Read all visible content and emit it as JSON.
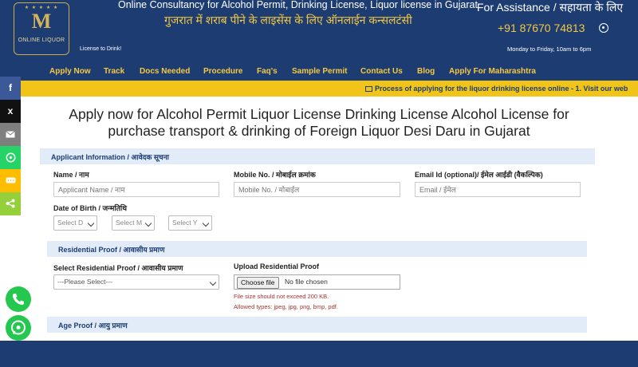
{
  "header": {
    "logo_text": "ONLINE LIQUOR",
    "tagline": "License to Drink!",
    "title_en": "Online Consultancy for Alcohol Permit, Drinking License, Liquor license in Gujarat",
    "title_hi": "गुजरात में शराब पीने के लाइसेंस के लिए ऑनलाईन कन्सलटंसी",
    "assistance": "For Assistance / सहायता के लिए",
    "phone": "+91 87670 74813",
    "hours": "Monday to Friday, 10am to 6pm"
  },
  "nav": {
    "items": [
      "Apply Now",
      "Track",
      "Docs Needed",
      "Procedure",
      "Faq's",
      "Sample Permit",
      "Contact Us",
      "Blog",
      "Apply For Maharashtra"
    ]
  },
  "ticker": {
    "text": "Process of applying for the liquor drinking license online - 1. Visit our web"
  },
  "share": {
    "facebook": "f",
    "twitter": "x",
    "email": "email",
    "whatsapp": "whatsapp",
    "sms": "sms",
    "share": "share"
  },
  "page": {
    "heading": "Apply now for Alcohol Permit Liquor License Drinking License Alcohol License for purchase transport & drinking of Foreign Liquor Desi Daru in Gujarat"
  },
  "applicant": {
    "section_title": "Applicant Information / आवेदक सूचना",
    "name_label": "Name / नाम",
    "name_placeholder": "Applicant Name / नाम",
    "mobile_label": "Mobile No. / मोबाईल क्रमांक",
    "mobile_placeholder": "Mobile No. / मोबाईल",
    "email_label": "Email Id (optional)/ ईमेल आईडी (वैकल्पिक)",
    "email_placeholder": "Email / ईमेल",
    "dob_label": "Date of Birth / जन्मतिथि",
    "dob_day": "Select D",
    "dob_month": "Select M",
    "dob_year": "Select Y"
  },
  "residential": {
    "section_title": "Residential Proof / आवासीय प्रमाण",
    "select_label": "Select Residential Proof / आवासीय प्रमाण",
    "select_value": "---Please Select---",
    "upload_label": "Upload Residential Proof",
    "file_button": "Choose file",
    "file_status": "No file chosen",
    "note_size": "File size should not exceed 200 KB.",
    "note_types": "Allowed types: jpeg, jpg, png, bmp, pdf."
  },
  "age": {
    "section_title": "Age Proof / आयु प्रमाण"
  },
  "colors": {
    "navy": "#1d3d72",
    "gold": "#f4c842",
    "ticker_bg": "#f0c419",
    "section_bg": "#e2ecf8",
    "facebook": "#3b5998",
    "twitter": "#111111",
    "email": "#7f7f7f",
    "whatsapp": "#25d366",
    "sms": "#ffbd00",
    "share": "#95d03a"
  }
}
